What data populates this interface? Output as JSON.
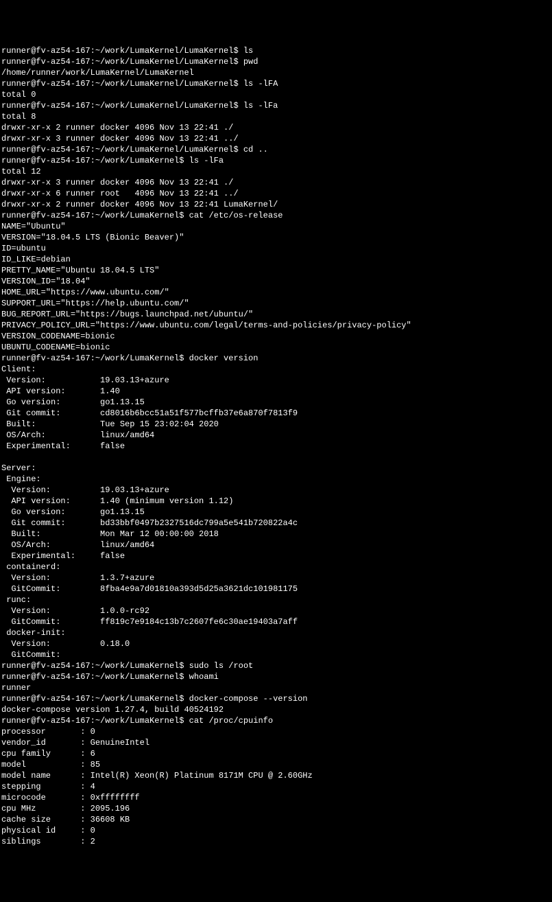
{
  "prompt1": "runner@fv-az54-167:~/work/LumaKernel/LumaKernel$",
  "prompt2": "runner@fv-az54-167:~/work/LumaKernel$",
  "lines": [
    {
      "p": "p1",
      "c": "ls"
    },
    {
      "p": "p1",
      "c": "pwd"
    },
    {
      "t": "/home/runner/work/LumaKernel/LumaKernel"
    },
    {
      "p": "p1",
      "c": "ls -lFA"
    },
    {
      "t": "total 0"
    },
    {
      "p": "p1",
      "c": "ls -lFa"
    },
    {
      "t": "total 8"
    },
    {
      "t": "drwxr-xr-x 2 runner docker 4096 Nov 13 22:41 ./"
    },
    {
      "t": "drwxr-xr-x 3 runner docker 4096 Nov 13 22:41 ../"
    },
    {
      "p": "p1",
      "c": "cd .."
    },
    {
      "p": "p2",
      "c": "ls -lFa"
    },
    {
      "t": "total 12"
    },
    {
      "t": "drwxr-xr-x 3 runner docker 4096 Nov 13 22:41 ./"
    },
    {
      "t": "drwxr-xr-x 6 runner root   4096 Nov 13 22:41 ../"
    },
    {
      "t": "drwxr-xr-x 2 runner docker 4096 Nov 13 22:41 LumaKernel/"
    },
    {
      "p": "p2",
      "c": "cat /etc/os-release"
    },
    {
      "t": "NAME=\"Ubuntu\""
    },
    {
      "t": "VERSION=\"18.04.5 LTS (Bionic Beaver)\""
    },
    {
      "t": "ID=ubuntu"
    },
    {
      "t": "ID_LIKE=debian"
    },
    {
      "t": "PRETTY_NAME=\"Ubuntu 18.04.5 LTS\""
    },
    {
      "t": "VERSION_ID=\"18.04\""
    },
    {
      "t": "HOME_URL=\"https://www.ubuntu.com/\""
    },
    {
      "t": "SUPPORT_URL=\"https://help.ubuntu.com/\""
    },
    {
      "t": "BUG_REPORT_URL=\"https://bugs.launchpad.net/ubuntu/\""
    },
    {
      "t": "PRIVACY_POLICY_URL=\"https://www.ubuntu.com/legal/terms-and-policies/privacy-policy\""
    },
    {
      "t": "VERSION_CODENAME=bionic"
    },
    {
      "t": "UBUNTU_CODENAME=bionic"
    },
    {
      "p": "p2",
      "c": "docker version"
    },
    {
      "t": "Client:"
    },
    {
      "t": " Version:           19.03.13+azure"
    },
    {
      "t": " API version:       1.40"
    },
    {
      "t": " Go version:        go1.13.15"
    },
    {
      "t": " Git commit:        cd8016b6bcc51a51f577bcffb37e6a870f7813f9"
    },
    {
      "t": " Built:             Tue Sep 15 23:02:04 2020"
    },
    {
      "t": " OS/Arch:           linux/amd64"
    },
    {
      "t": " Experimental:      false"
    },
    {
      "t": ""
    },
    {
      "t": "Server:"
    },
    {
      "t": " Engine:"
    },
    {
      "t": "  Version:          19.03.13+azure"
    },
    {
      "t": "  API version:      1.40 (minimum version 1.12)"
    },
    {
      "t": "  Go version:       go1.13.15"
    },
    {
      "t": "  Git commit:       bd33bbf0497b2327516dc799a5e541b720822a4c"
    },
    {
      "t": "  Built:            Mon Mar 12 00:00:00 2018"
    },
    {
      "t": "  OS/Arch:          linux/amd64"
    },
    {
      "t": "  Experimental:     false"
    },
    {
      "t": " containerd:"
    },
    {
      "t": "  Version:          1.3.7+azure"
    },
    {
      "t": "  GitCommit:        8fba4e9a7d01810a393d5d25a3621dc101981175"
    },
    {
      "t": " runc:"
    },
    {
      "t": "  Version:          1.0.0-rc92"
    },
    {
      "t": "  GitCommit:        ff819c7e9184c13b7c2607fe6c30ae19403a7aff"
    },
    {
      "t": " docker-init:"
    },
    {
      "t": "  Version:          0.18.0"
    },
    {
      "t": "  GitCommit:        "
    },
    {
      "p": "p2",
      "c": "sudo ls /root"
    },
    {
      "p": "p2",
      "c": "whoami"
    },
    {
      "t": "runner"
    },
    {
      "p": "p2",
      "c": "docker-compose --version"
    },
    {
      "t": "docker-compose version 1.27.4, build 40524192"
    },
    {
      "p": "p2",
      "c": "cat /proc/cpuinfo"
    },
    {
      "t": "processor       : 0"
    },
    {
      "t": "vendor_id       : GenuineIntel"
    },
    {
      "t": "cpu family      : 6"
    },
    {
      "t": "model           : 85"
    },
    {
      "t": "model name      : Intel(R) Xeon(R) Platinum 8171M CPU @ 2.60GHz"
    },
    {
      "t": "stepping        : 4"
    },
    {
      "t": "microcode       : 0xffffffff"
    },
    {
      "t": "cpu MHz         : 2095.196"
    },
    {
      "t": "cache size      : 36608 KB"
    },
    {
      "t": "physical id     : 0"
    },
    {
      "t": "siblings        : 2"
    }
  ]
}
